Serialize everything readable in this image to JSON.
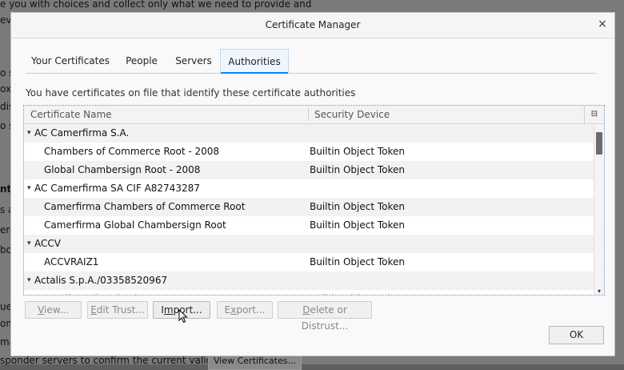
{
  "background": {
    "lines": [
      {
        "text": "e you with choices and collect only what we need to provide and",
        "bold": false
      },
      {
        "text": "ev",
        "bold": false
      },
      {
        "text": "o s",
        "bold": false
      },
      {
        "text": "ox",
        "bold": false
      },
      {
        "text": "dis",
        "bold": false
      },
      {
        "text": "o se",
        "bold": false
      },
      {
        "text": "nt",
        "bold": true
      },
      {
        "text": "s a",
        "bold": false
      },
      {
        "text": "ero",
        "bold": false
      },
      {
        "text": "bo",
        "bold": false
      },
      {
        "text": "ues",
        "bold": false
      },
      {
        "text": "oma",
        "bold": false
      },
      {
        "text": "ma",
        "bold": false
      },
      {
        "text": "sponder servers to confirm the current validity of",
        "bold": false
      }
    ],
    "view_certs_button": "View Certificates..."
  },
  "dialog": {
    "title": "Certificate Manager",
    "close_glyph": "×",
    "tabs": [
      {
        "label": "Your Certificates"
      },
      {
        "label": "People"
      },
      {
        "label": "Servers"
      },
      {
        "label": "Authorities",
        "active": true
      }
    ],
    "description": "You have certificates on file that identify these certificate authorities",
    "tree": {
      "columns": [
        "Certificate Name",
        "Security Device"
      ],
      "column_picker_icon": "column-picker-icon",
      "rows": [
        {
          "level": 0,
          "name": "AC Camerfirma S.A.",
          "device": "",
          "expanded": true
        },
        {
          "level": 1,
          "name": "Chambers of Commerce Root - 2008",
          "device": "Builtin Object Token"
        },
        {
          "level": 1,
          "name": "Global Chambersign Root - 2008",
          "device": "Builtin Object Token"
        },
        {
          "level": 0,
          "name": "AC Camerfirma SA CIF A82743287",
          "device": "",
          "expanded": true
        },
        {
          "level": 1,
          "name": "Camerfirma Chambers of Commerce Root",
          "device": "Builtin Object Token"
        },
        {
          "level": 1,
          "name": "Camerfirma Global Chambersign Root",
          "device": "Builtin Object Token"
        },
        {
          "level": 0,
          "name": "ACCV",
          "device": "",
          "expanded": true
        },
        {
          "level": 1,
          "name": "ACCVRAIZ1",
          "device": "Builtin Object Token"
        },
        {
          "level": 0,
          "name": "Actalis S.p.A./03358520967",
          "device": "",
          "expanded": true
        },
        {
          "level": 1,
          "name": "Actalis Authentication Root CA",
          "device": "Builtin Object Token"
        }
      ]
    },
    "buttons": {
      "view": {
        "label": "View...",
        "mnemonic": "V",
        "rest": "iew..."
      },
      "edit_trust": {
        "label": "Edit Trust...",
        "mnemonic": "E",
        "rest": "dit Trust..."
      },
      "import": {
        "label": "Import...",
        "mnemonic": "m",
        "pre": "I",
        "rest": "port..."
      },
      "export": {
        "label": "Export...",
        "mnemonic": "x",
        "pre": "E",
        "rest": "port..."
      },
      "delete": {
        "label": "Delete or Distrust...",
        "mnemonic": "D",
        "rest": "elete or Distrust..."
      },
      "ok": "OK"
    }
  }
}
